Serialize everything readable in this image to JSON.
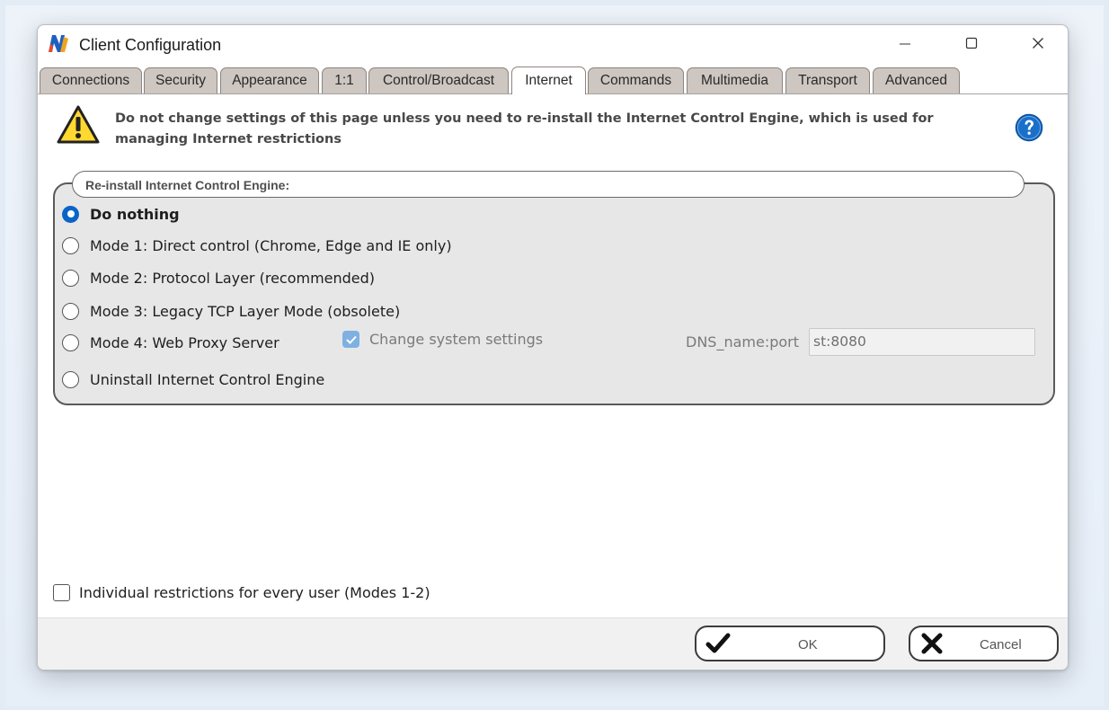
{
  "window": {
    "title": "Client Configuration",
    "controls": [
      "minimize",
      "maximize",
      "close"
    ]
  },
  "tabs": [
    {
      "label": "Connections",
      "active": false
    },
    {
      "label": "Security",
      "active": false
    },
    {
      "label": "Appearance",
      "active": false
    },
    {
      "label": "1:1",
      "active": false
    },
    {
      "label": "Control/Broadcast",
      "active": false
    },
    {
      "label": "Internet",
      "active": true
    },
    {
      "label": "Commands",
      "active": false
    },
    {
      "label": "Multimedia",
      "active": false
    },
    {
      "label": "Transport",
      "active": false
    },
    {
      "label": "Advanced",
      "active": false
    }
  ],
  "warning": {
    "icon": "warning-triangle-icon",
    "text": "Do not change settings of this page unless you need to re-install the Internet Control Engine, which is used for managing Internet restrictions",
    "help_icon": "help-question-icon"
  },
  "group": {
    "title": "Re-install Internet Control Engine:",
    "options": [
      {
        "label": "Do nothing",
        "selected": true
      },
      {
        "label": "Mode 1: Direct control (Chrome, Edge and IE only)",
        "selected": false
      },
      {
        "label": "Mode 2: Protocol Layer (recommended)",
        "selected": false
      },
      {
        "label": "Mode 3: Legacy TCP Layer Mode (obsolete)",
        "selected": false
      },
      {
        "label": "Mode 4: Web Proxy Server",
        "selected": false
      },
      {
        "label": "Uninstall Internet Control Engine",
        "selected": false
      }
    ],
    "change_system_settings": {
      "label": "Change system settings",
      "checked": true,
      "enabled": false
    },
    "dns": {
      "label": "DNS_name:port",
      "value": "st:8080"
    }
  },
  "individual_restrictions": {
    "label": "Individual restrictions for every user (Modes 1-2)",
    "checked": false
  },
  "buttons": {
    "ok": {
      "label": "OK",
      "icon": "checkmark-icon"
    },
    "cancel": {
      "label": "Cancel",
      "icon": "x-mark-icon"
    }
  },
  "colors": {
    "accent": "#0a64c7",
    "tab_inactive": "#cdc6c1",
    "group_bg": "#e7e7e7",
    "warning_yellow": "#ffd830",
    "help_blue": "#1a6fc9"
  }
}
